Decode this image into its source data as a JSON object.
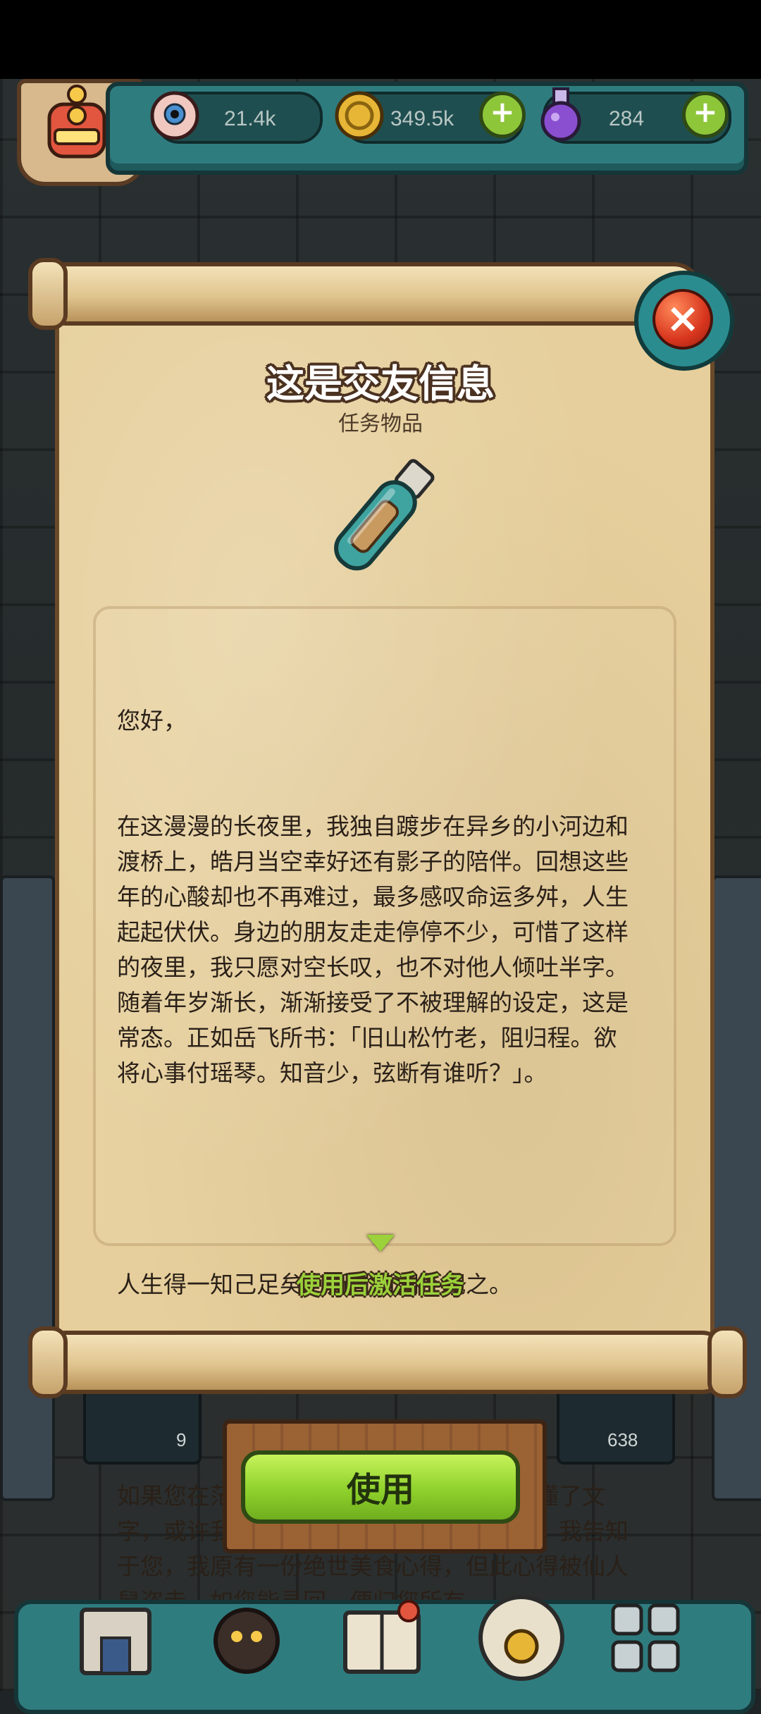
{
  "resources": {
    "eyes": "21.4k",
    "coins": "349.5k",
    "potions": "284"
  },
  "dialog": {
    "title": "这是交友信息",
    "subtitle": "任务物品",
    "item_icon": "bottle-message-icon",
    "letter": [
      "您好，",
      "在这漫漫的长夜里，我独自踱步在异乡的小河边和渡桥上，皓月当空幸好还有影子的陪伴。回想这些年的心酸却也不再难过，最多感叹命运多舛，人生起起伏伏。身边的朋友走走停停不少，可惜了这样的夜里，我只愿对空长叹，也不对他人倾吐半字。随着年岁渐长，渐渐接受了不被理解的设定，这是常态。正如岳飞所书：「旧山松竹老，阻归程。欲将心事付瑶琴。知音少，弦断有谁听？」。",
      "",
      "人生得一知己足矣，斯世当同怀视之。",
      "",
      "如果您在茫茫之中拾起这破瓶，恰巧又读懂了文字，或许我在世为人就不再孤寂了。为此，我告知于您，我原有一份绝世美食心得，但此心得被仙人鼠盗走，如您能寻回，便归您所有。"
    ],
    "hint": "使用后激活任务",
    "use_button": "使用"
  },
  "background_slots": {
    "slot_left_count": "9",
    "slot_right_count": "638"
  },
  "colors": {
    "parchment": "#e6cf9c",
    "accent_green": "#9bd13a",
    "teal_frame": "#2f7c7f",
    "close_red": "#d8361e"
  }
}
